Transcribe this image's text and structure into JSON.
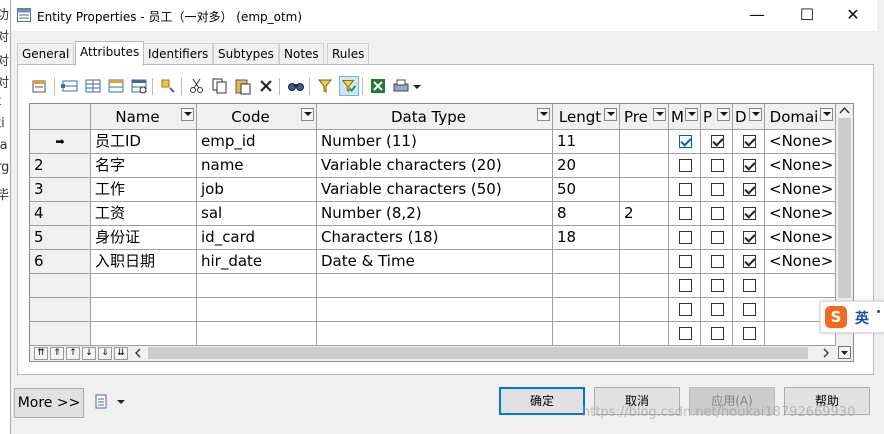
{
  "background_fragments": [
    "功",
    "对",
    "对",
    "对",
    "t",
    "ti",
    "la",
    "rg",
    "毕"
  ],
  "window": {
    "title": "Entity Properties - 员工（一对多） (emp_otm)",
    "minimize_glyph": "—",
    "maximize_glyph": "☐",
    "close_glyph": "✕"
  },
  "tabs": [
    "General",
    "Attributes",
    "Identifiers",
    "Subtypes",
    "Notes",
    "Rules"
  ],
  "active_tab": "Attributes",
  "grid": {
    "columns": [
      "Name",
      "Code",
      "Data Type",
      "Lengt",
      "Pre",
      "M",
      "P",
      "D",
      "Domai"
    ],
    "rows": [
      {
        "num": "",
        "current_marker": "➡",
        "name": "员工ID",
        "code": "emp_id",
        "type": "Number (11)",
        "length": "11",
        "precision": "",
        "m": true,
        "p": true,
        "d": true,
        "domain": "<None>"
      },
      {
        "num": "2",
        "current_marker": "",
        "name": "名字",
        "code": "name",
        "type": "Variable characters (20)",
        "length": "20",
        "precision": "",
        "m": false,
        "p": false,
        "d": true,
        "domain": "<None>"
      },
      {
        "num": "3",
        "current_marker": "",
        "name": "工作",
        "code": "job",
        "type": "Variable characters (50)",
        "length": "50",
        "precision": "",
        "m": false,
        "p": false,
        "d": true,
        "domain": "<None>"
      },
      {
        "num": "4",
        "current_marker": "",
        "name": "工资",
        "code": "sal",
        "type": "Number (8,2)",
        "length": "8",
        "precision": "2",
        "m": false,
        "p": false,
        "d": true,
        "domain": "<None>"
      },
      {
        "num": "5",
        "current_marker": "",
        "name": "身份证",
        "code": "id_card",
        "type": "Characters (18)",
        "length": "18",
        "precision": "",
        "m": false,
        "p": false,
        "d": true,
        "domain": "<None>"
      },
      {
        "num": "6",
        "current_marker": "",
        "name": "入职日期",
        "code": "hir_date",
        "type": "Date & Time",
        "length": "",
        "precision": "",
        "m": false,
        "p": false,
        "d": true,
        "domain": "<None>"
      }
    ],
    "empty_rows": 3
  },
  "buttons": {
    "more": "More >>",
    "ok": "确定",
    "cancel": "取消",
    "apply": "应用(A)",
    "help": "帮助"
  },
  "ime": {
    "label": "英",
    "logo": "S"
  },
  "watermark": "https://blog.csdn.net/houkai18792669930",
  "colors": {
    "default_button_border": "#0078d7",
    "check_blue": "#0063b1",
    "ime_orange": "#f26a21"
  }
}
